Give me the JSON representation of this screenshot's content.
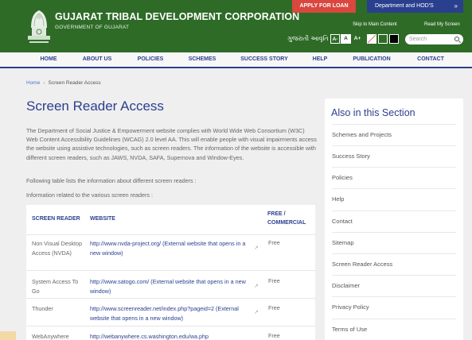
{
  "header": {
    "org_title": "GUJARAT TRIBAL DEVELOPMENT CORPORATION",
    "org_subtitle": "GOVERNMENT OF GUJARAT",
    "apply_label": "APPLY FOR LOAN",
    "dept_label": "Department and HOD'S",
    "skip_label": "Skip to Main Content",
    "read_label": "Read My Screen",
    "language_label": "ગુજરાતી આવૃતિ",
    "font_small": "A-",
    "font_normal": "A",
    "font_large": "A+",
    "search_placeholder": "Search"
  },
  "nav": [
    "HOME",
    "ABOUT US",
    "POLICIES",
    "SCHEMES",
    "SUCCESS STORY",
    "HELP",
    "PUBLICATION",
    "CONTACT"
  ],
  "breadcrumb": {
    "home": "Home",
    "current": "Screen Reader Access"
  },
  "main": {
    "title": "Screen Reader Access",
    "intro": "The Department of Social Justice & Empowerment website complies with World Wide Web Consortium (W3C) Web Content Accessibility Guidelines (WCAG) 2.0 level AA. This will enable people with visual impairments access the website using assistive technologies, such as screen readers. The information of the website is accessible with different screen readers, such as JAWS, NVDA, SAFA, Supernova and Window-Eyes.",
    "line1": "Following table lists the information about different screen readers :",
    "line2": "Information related to the various screen readers :"
  },
  "table": {
    "headers": [
      "SCREEN READER",
      "WEBSITE",
      "FREE / COMMERCIAL"
    ],
    "rows": [
      {
        "name": "Non Visual Desktop Access (NVDA)",
        "url": "http://www.nvda-project.org/ (External website that opens in a new window)",
        "type": "Free"
      },
      {
        "name": "System Access To Go",
        "url": "http://www.satogo.com/ (External website that opens in a new window)",
        "type": "Free"
      },
      {
        "name": "Thunder",
        "url": "http://www.screenreader.net/index.php?pageid=2 (External website that opens in a new window)",
        "type": "Free"
      },
      {
        "name": "WebAnywhere",
        "url": "http://webanywhere.cs.washington.edu/wa.php",
        "type": "Free"
      }
    ]
  },
  "sidebar": {
    "title": "Also in this Section",
    "items": [
      "Schemes and Projects",
      "Success Story",
      "Policies",
      "Help",
      "Contact",
      "Sitemap",
      "Screen Reader Access",
      "Disclaimer",
      "Privacy Policy",
      "Terms of Use"
    ]
  },
  "colors": {
    "header_green": "#2e6b27",
    "nav_blue": "#2b3f8f",
    "apply_red": "#d9473f"
  }
}
